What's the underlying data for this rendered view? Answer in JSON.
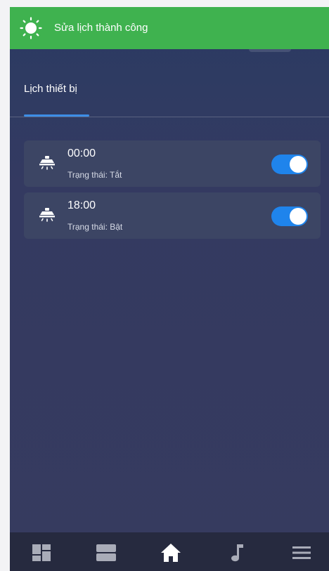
{
  "toast": {
    "message": "Sửa lịch thành công",
    "icon": "sun-icon",
    "color": "#3fb24f"
  },
  "tabs": [
    {
      "label": "Lịch thiết bị",
      "active": true
    }
  ],
  "schedules": [
    {
      "time": "00:00",
      "status": "Trạng thái: Tắt",
      "enabled": true,
      "icon": "ceiling-light-icon"
    },
    {
      "time": "18:00",
      "status": "Trạng thái: Bật",
      "enabled": true,
      "icon": "ceiling-light-icon"
    }
  ],
  "bottom_nav": [
    {
      "icon": "dashboard-icon",
      "active": false
    },
    {
      "icon": "rooms-icon",
      "active": false
    },
    {
      "icon": "home-icon",
      "active": true
    },
    {
      "icon": "music-icon",
      "active": false
    },
    {
      "icon": "menu-icon",
      "active": false
    }
  ],
  "colors": {
    "accent": "#1f84ec",
    "toast": "#3fb24f",
    "card": "#3c4564",
    "nav_bg": "#262a3f"
  }
}
